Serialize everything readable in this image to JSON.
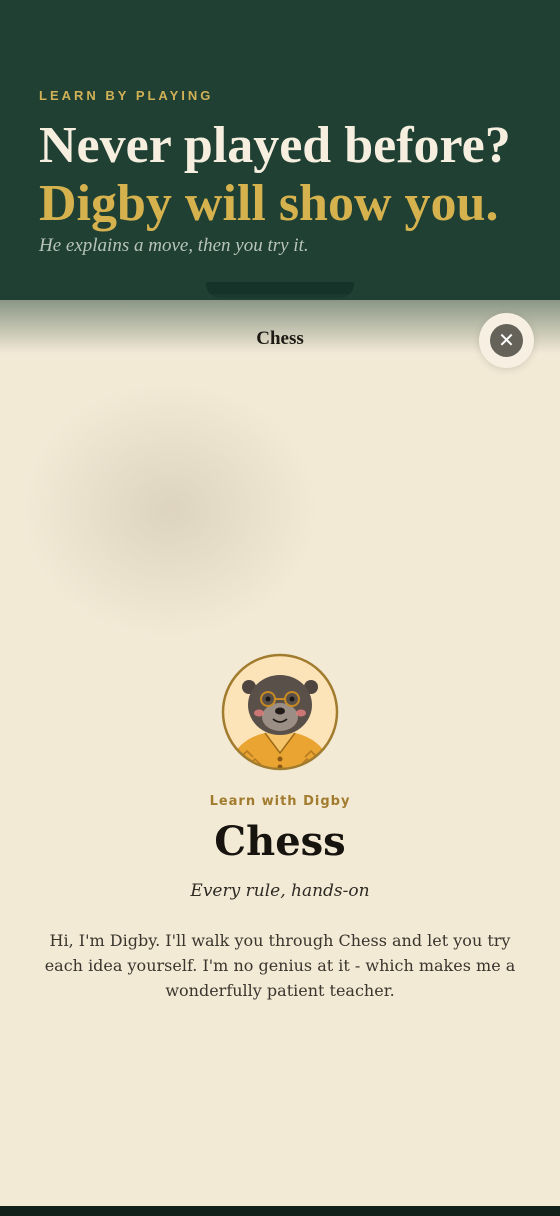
{
  "hero": {
    "eyebrow": "LEARN BY PLAYING",
    "title_line1": "Never played before?",
    "title_line2": "Digby will show you.",
    "subtitle": "He explains a move, then you try it."
  },
  "sheet": {
    "title": "Chess",
    "close_symbol": "✕",
    "close_icon": "close-icon"
  },
  "lesson": {
    "avatar": "otter-mascot-avatar",
    "kicker": "Learn with Digby",
    "title": "Chess",
    "tagline": "Every rule, hands-on",
    "intro": "Hi, I'm Digby. I'll walk you through Chess and let you try each idea yourself. I'm no genius at it - which makes me a wonderfully patient teacher."
  },
  "colors": {
    "hero_bg": "#1f4033",
    "accent_gold": "#d6b24e",
    "sheet_bg": "#f3ead6",
    "kicker": "#a27c2e"
  }
}
